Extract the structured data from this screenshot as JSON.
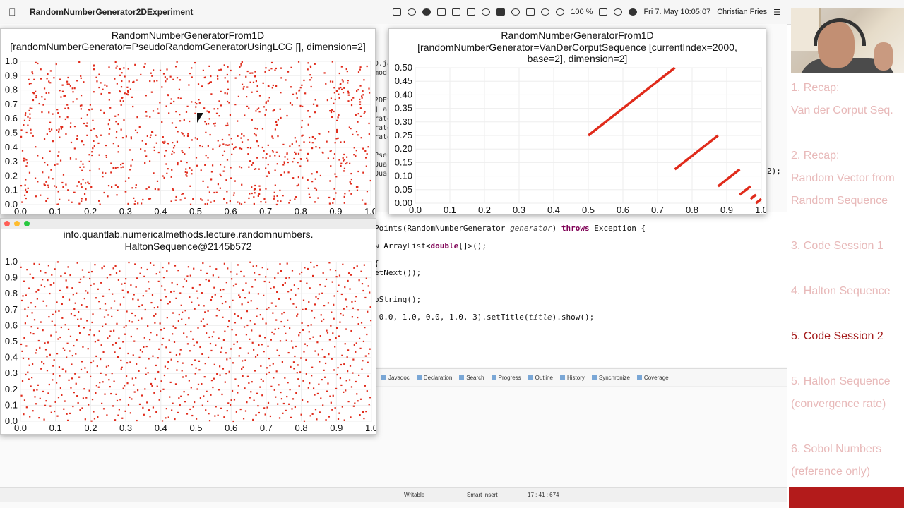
{
  "menubar": {
    "app_name": "RandomNumberGenerator2DExperiment",
    "zoom": "100 %",
    "datetime": "Fri 7. May  10:05:07",
    "user": "Christian Fries"
  },
  "ide": {
    "left_fragment": "D.java\nmods\n\n\n2DEx\n] a\nrato\nrato\nrato\n\nPseu\nQuas\nQuas",
    "right_fragment": "2);",
    "code_lines": [
      {
        "pre": "Points(RandomNumberGenerator ",
        "it": "generator",
        "post": ") ",
        "kw": "throws",
        "post2": " Exception {"
      },
      {
        "pre": "w ArrayList<",
        "kw2": "double",
        "post": "[]>();"
      },
      {
        "pre": "{"
      },
      {
        "pre": "etNext());"
      },
      {
        "pre": "oString();"
      },
      {
        "pre": " 0.0, 1.0, 0.0, 1.0, 3).setTitle(",
        "it": "title",
        "post": ").show();"
      }
    ],
    "view_tabs": [
      "Javadoc",
      "Declaration",
      "Search",
      "Progress",
      "Outline",
      "History",
      "Synchronize",
      "Coverage"
    ],
    "statusbar": {
      "mode": "Writable",
      "insert": "Smart Insert",
      "position": "17 : 41 : 674"
    }
  },
  "windows": [
    {
      "id": "lcg",
      "title1": "RandomNumberGeneratorFrom1D",
      "title2": "[randomNumberGenerator=PseudoRandomGeneratorUsingLCG [], dimension=2]"
    },
    {
      "id": "vdc",
      "title1": "RandomNumberGeneratorFrom1D",
      "title2": "[randomNumberGenerator=VanDerCorputSequence [currentIndex=2000,",
      "title3": "base=2], dimension=2]"
    },
    {
      "id": "halton",
      "title1": "info.quantlab.numericalmethods.lecture.randomnumbers.",
      "title2": "HaltonSequence@2145b572"
    }
  ],
  "chart_data": [
    {
      "type": "scatter",
      "name": "lcg",
      "n_points": 1000,
      "xlim": [
        0.0,
        1.0
      ],
      "ylim": [
        0.0,
        1.0
      ],
      "xticks": [
        "0.0",
        "0.1",
        "0.2",
        "0.3",
        "0.4",
        "0.5",
        "0.6",
        "0.7",
        "0.8",
        "0.9",
        "1.0"
      ],
      "yticks": [
        "0.0",
        "0.1",
        "0.2",
        "0.3",
        "0.4",
        "0.5",
        "0.6",
        "0.7",
        "0.8",
        "0.9",
        "1.0"
      ],
      "color": "#e02b1b",
      "pattern": "pseudo-random (uniform, clustered)"
    },
    {
      "type": "scatter",
      "name": "vdc",
      "xlim": [
        0.0,
        1.0
      ],
      "ylim": [
        0.0,
        0.5
      ],
      "xticks": [
        "0.0",
        "0.1",
        "0.2",
        "0.3",
        "0.4",
        "0.5",
        "0.6",
        "0.7",
        "0.8",
        "0.9",
        "1.0"
      ],
      "yticks": [
        "0.00",
        "0.05",
        "0.10",
        "0.15",
        "0.20",
        "0.25",
        "0.30",
        "0.35",
        "0.40",
        "0.45",
        "0.50"
      ],
      "color": "#e02b1b",
      "segments": [
        {
          "x": [
            0.5,
            0.75
          ],
          "y": [
            0.25,
            0.5
          ]
        },
        {
          "x": [
            0.75,
            0.875
          ],
          "y": [
            0.125,
            0.25
          ]
        },
        {
          "x": [
            0.875,
            0.9375
          ],
          "y": [
            0.0625,
            0.125
          ]
        },
        {
          "x": [
            0.9375,
            0.96875
          ],
          "y": [
            0.03125,
            0.0625
          ]
        },
        {
          "x": [
            0.96875,
            0.984375
          ],
          "y": [
            0.015625,
            0.03125
          ]
        },
        {
          "x": [
            0.984375,
            1.0
          ],
          "y": [
            0.0,
            0.015625
          ]
        }
      ]
    },
    {
      "type": "scatter",
      "name": "halton",
      "n_points": 1000,
      "xlim": [
        0.0,
        1.0
      ],
      "ylim": [
        0.0,
        1.0
      ],
      "xticks": [
        "0.0",
        "0.1",
        "0.2",
        "0.3",
        "0.4",
        "0.5",
        "0.6",
        "0.7",
        "0.8",
        "0.9",
        "1.0"
      ],
      "yticks": [
        "0.0",
        "0.1",
        "0.2",
        "0.3",
        "0.4",
        "0.5",
        "0.6",
        "0.7",
        "0.8",
        "0.9",
        "1.0"
      ],
      "color": "#e02b1b",
      "pattern": "halton bases 2 and 3"
    }
  ],
  "slides": {
    "items": [
      {
        "text": "1. Recap:",
        "current": false
      },
      {
        "text": "Van der Corput Seq.",
        "current": false
      },
      {
        "text": "2. Recap:",
        "current": false
      },
      {
        "text": "Random Vector from",
        "current": false
      },
      {
        "text": "Random Sequence",
        "current": false
      },
      {
        "text": "3. Code Session 1",
        "current": false
      },
      {
        "text": "4. Halton Sequence",
        "current": false
      },
      {
        "text": "5. Code Session 2",
        "current": true
      },
      {
        "text": "5. Halton Sequence",
        "current": false
      },
      {
        "text": "(convergence rate)",
        "current": false
      },
      {
        "text": "6. Sobol Numbers",
        "current": false
      },
      {
        "text": "(reference only)",
        "current": false
      }
    ],
    "accent": "#a51c1c",
    "faded": "#e8b9b9"
  }
}
